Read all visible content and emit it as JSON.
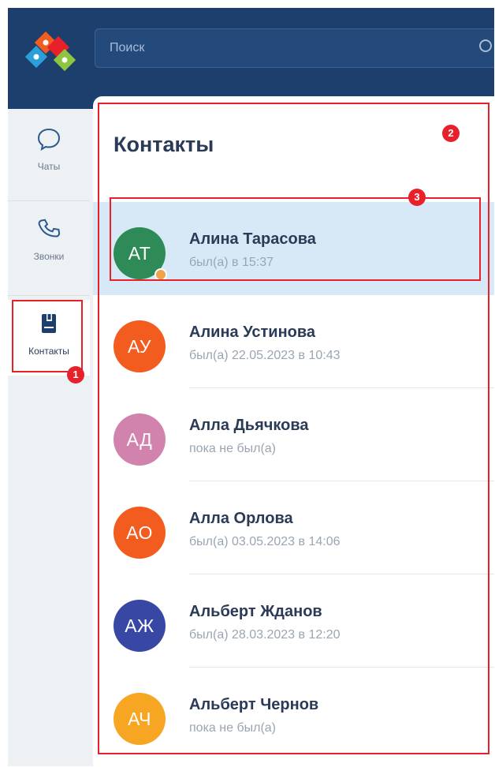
{
  "header": {
    "search_placeholder": "Поиск"
  },
  "rail": {
    "items": [
      {
        "label": "Чаты",
        "icon": "chat-bubble-icon"
      },
      {
        "label": "Звонки",
        "icon": "phone-icon"
      },
      {
        "label": "Контакты",
        "icon": "contacts-book-icon",
        "active": true
      }
    ]
  },
  "panel": {
    "title": "Контакты"
  },
  "contacts": [
    {
      "initials": "АТ",
      "name": "Алина Тарасова",
      "status": "был(а) в 15:37",
      "color": "#2e8b57",
      "presence": "away",
      "selected": true
    },
    {
      "initials": "АУ",
      "name": "Алина Устинова",
      "status": "был(а) 22.05.2023 в 10:43",
      "color": "#f25c1e"
    },
    {
      "initials": "АД",
      "name": "Алла Дьячкова",
      "status": "пока не был(а)",
      "color": "#d283ad"
    },
    {
      "initials": "АО",
      "name": "Алла Орлова",
      "status": "был(а) 03.05.2023 в 14:06",
      "color": "#f25c1e"
    },
    {
      "initials": "АЖ",
      "name": "Альберт Жданов",
      "status": "был(а) 28.03.2023 в 12:20",
      "color": "#3847a3"
    },
    {
      "initials": "АЧ",
      "name": "Альберт Чернов",
      "status": "пока не был(а)",
      "color": "#f6a623"
    }
  ],
  "annotations": {
    "markers": [
      "1",
      "2",
      "3"
    ],
    "color": "#e8202a"
  }
}
